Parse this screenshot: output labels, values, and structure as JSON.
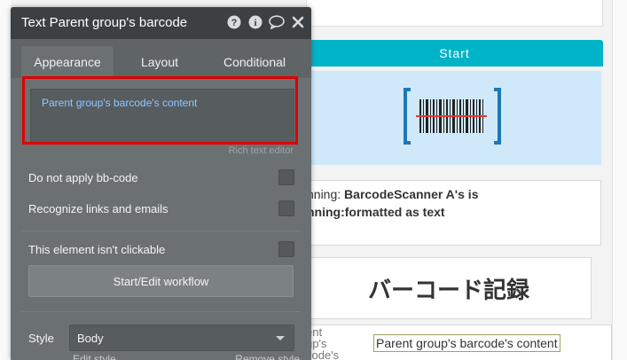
{
  "background": {
    "start_label": "Start",
    "scanner_text_line1_prefix": "nning: ",
    "scanner_text_line1_bold": "BarcodeScanner A's is",
    "scanner_text_line2_bold": "nning:formatted as text",
    "heading_jp": "バーコード記録",
    "bottom_small_text": "ent\nup's\ncode's",
    "content_chip": "Parent group's barcode's content",
    "colors": {
      "start_bar": "#00b4c8",
      "scanner_bg": "#cfe9fb",
      "barcode_icon": "#1f78b4"
    }
  },
  "panel": {
    "title": "Text Parent group's barcode",
    "header_icons": [
      "help-icon",
      "info-icon",
      "comment-icon",
      "close-icon"
    ],
    "tabs": [
      {
        "label": "Appearance",
        "active": true
      },
      {
        "label": "Layout",
        "active": false
      },
      {
        "label": "Conditional",
        "active": false
      }
    ],
    "rich_text": {
      "content": "Parent group's barcode's content",
      "caption": "Rich text editor"
    },
    "options": {
      "no_bbcode": "Do not apply bb-code",
      "recognize_links": "Recognize links and emails",
      "not_clickable": "This element isn't clickable"
    },
    "workflow_button": "Start/Edit workflow",
    "style": {
      "label": "Style",
      "value": "Body",
      "edit": "Edit style",
      "remove": "Remove style"
    },
    "colors": {
      "highlight": "#e00000",
      "link_text": "#8ec8ff"
    }
  }
}
